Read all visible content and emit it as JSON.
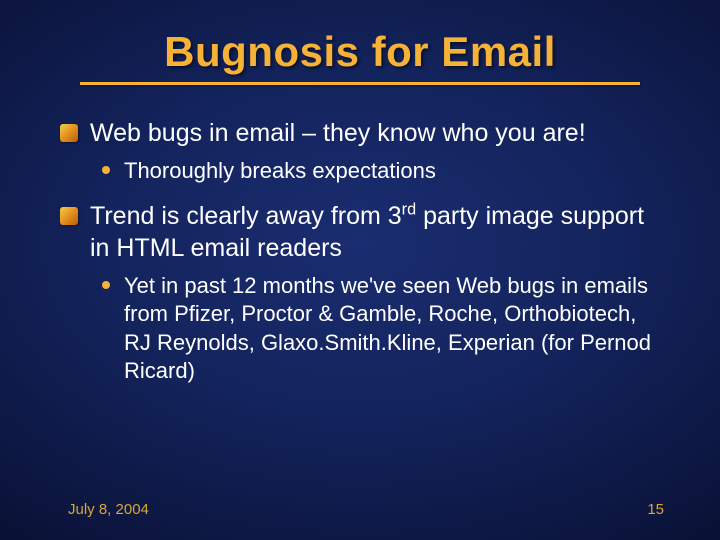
{
  "title": "Bugnosis for Email",
  "bullets": {
    "b1": "Web bugs in email – they know who you are!",
    "b1a": "Thoroughly breaks expectations",
    "b2_pre": "Trend is clearly away from 3",
    "b2_sup": "rd",
    "b2_post": " party image support in HTML email readers",
    "b2a": "Yet in past 12 months we've seen Web bugs in emails from Pfizer, Proctor & Gamble, Roche, Orthobiotech, RJ Reynolds, Glaxo.Smith.Kline, Experian (for Pernod Ricard)"
  },
  "footer": {
    "date": "July 8, 2004",
    "page": "15"
  }
}
